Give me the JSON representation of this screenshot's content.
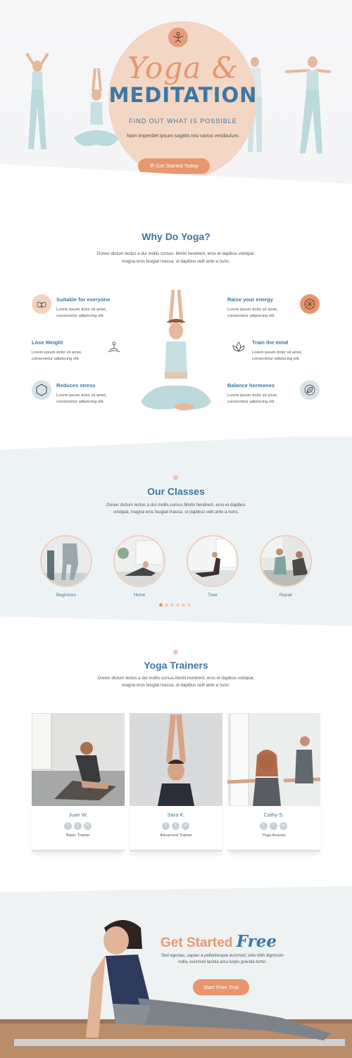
{
  "hero": {
    "title_script": "Yoga &",
    "title_main": "MEDITATION",
    "tagline": "FIND OUT WHAT IS POSSIBLE",
    "description": "Nam imperdiet ipsum sagittis nisi varius vestibulum.",
    "cta_label": "Get Started Today"
  },
  "why": {
    "title": "Why Do Yoga?",
    "text_line1": "Donec dictum lectus a dui mollis cursus. Morbi hendrerit, eros et dapibus volutpat,",
    "text_line2": "magna eros feugiat massa, ut dapibus velit ante a nunc.",
    "benefits": [
      {
        "title": "Suitable for everyone",
        "desc1": "Lorem ipsum dolor sit amet,",
        "desc2": "consectetur adipiscing elit.",
        "icon": "butterfly-icon"
      },
      {
        "title": "Lose Weight",
        "desc1": "Lorem ipsum dolor sit amet,",
        "desc2": "consectetur adipiscing elit.",
        "icon": "meditation-pose-icon"
      },
      {
        "title": "Reduces stress",
        "desc1": "Lorem ipsum dolor sit amet,",
        "desc2": "consectetur adipiscing elit.",
        "icon": "hexagon-icon"
      },
      {
        "title": "Raise your energy",
        "desc1": "Lorem ipsum dolor sit amet,",
        "desc2": "consectetur adipiscing elit.",
        "icon": "energy-icon"
      },
      {
        "title": "Train the mind",
        "desc1": "Lorem ipsum dolor sit amet,",
        "desc2": "consectetur adipiscing elit.",
        "icon": "lotus-icon"
      },
      {
        "title": "Balance hormones",
        "desc1": "Lorem ipsum dolor sit amet,",
        "desc2": "consectetur adipiscing elit.",
        "icon": "leaf-icon"
      }
    ]
  },
  "classes": {
    "title": "Our Classes",
    "text_line1": "Donec dictum lectus a dui mollis cursus.Morbi hendrerit, eros et dapibus",
    "text_line2": "volutpat, magna eros feugiat massa, ut dapibus velit ante a nunc.",
    "items": [
      {
        "label": "Beginners"
      },
      {
        "label": "Home"
      },
      {
        "label": "Tone"
      },
      {
        "label": "Repair"
      }
    ],
    "pager_count": 6,
    "pager_active": 1
  },
  "trainers": {
    "title": "Yoga Trainers",
    "text_line1": "Donec dictum lectus a dui mollis cursus.Morbi hendrerit, eros et dapibus volutpat,",
    "text_line2": "magna eros feugiat massa, ut dapibus velit ante a nunc.",
    "people": [
      {
        "name": "Juan W.",
        "role": "Basic Trainer"
      },
      {
        "name": "Sara K.",
        "role": "Advanced Trainer"
      },
      {
        "name": "Cathy S.",
        "role": "Yoga Asanas"
      }
    ],
    "social": [
      "f",
      "t",
      "in"
    ]
  },
  "cta": {
    "title": "Get Started",
    "title_script": "Free",
    "text_line1": "Sed egestas, sapien a pellentesque euismod, odio nibh dignissim",
    "text_line2": "nulla, euismod lacinia arcu turpis gravida tortor.",
    "button_label": "Start Free Trial"
  },
  "colors": {
    "accent": "#e8966d",
    "primary": "#3b78a3",
    "peach": "#f3d3bf",
    "mint": "#edf3f4"
  }
}
